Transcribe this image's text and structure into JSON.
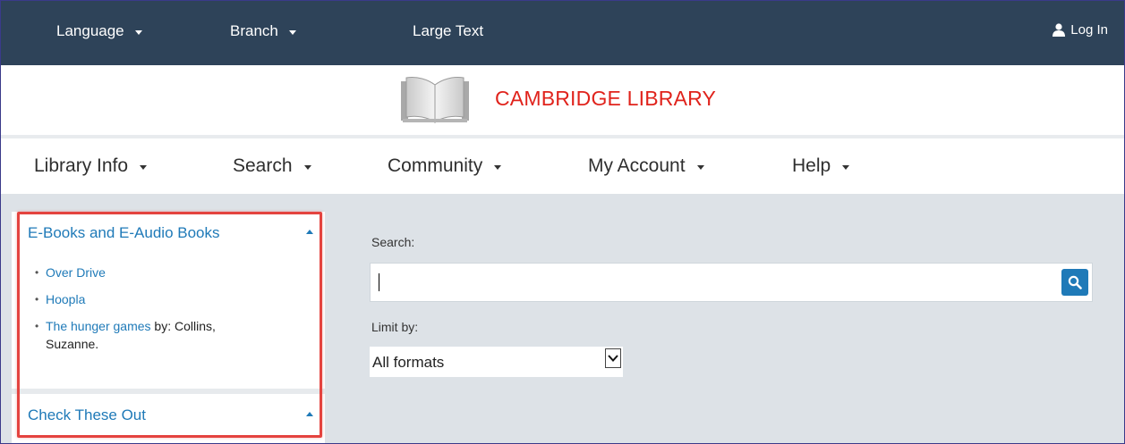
{
  "topbar": {
    "language": "Language",
    "branch": "Branch",
    "large_text": "Large Text",
    "login": "Log In"
  },
  "header": {
    "brand": "CAMBRIDGE LIBRARY",
    "logo_icon": "open-book-icon"
  },
  "nav": {
    "items": [
      {
        "label": "Library Info"
      },
      {
        "label": "Search"
      },
      {
        "label": "Community"
      },
      {
        "label": "My Account"
      },
      {
        "label": "Help"
      }
    ]
  },
  "sidebar": {
    "section1_title": "E-Books and E-Audio Books",
    "links": [
      {
        "title": "Over Drive",
        "suffix": ""
      },
      {
        "title": "Hoopla",
        "suffix": ""
      },
      {
        "title": "The hunger games",
        "suffix": " by: Collins, Suzanne."
      }
    ],
    "section2_title": "Check These Out"
  },
  "search": {
    "label": "Search:",
    "value": "",
    "limit_label": "Limit by:",
    "limit_value": "All formats"
  },
  "colors": {
    "topbar": "#2e4359",
    "brand": "#e0231c",
    "link": "#1f7ab8",
    "highlight": "#e4433f"
  }
}
